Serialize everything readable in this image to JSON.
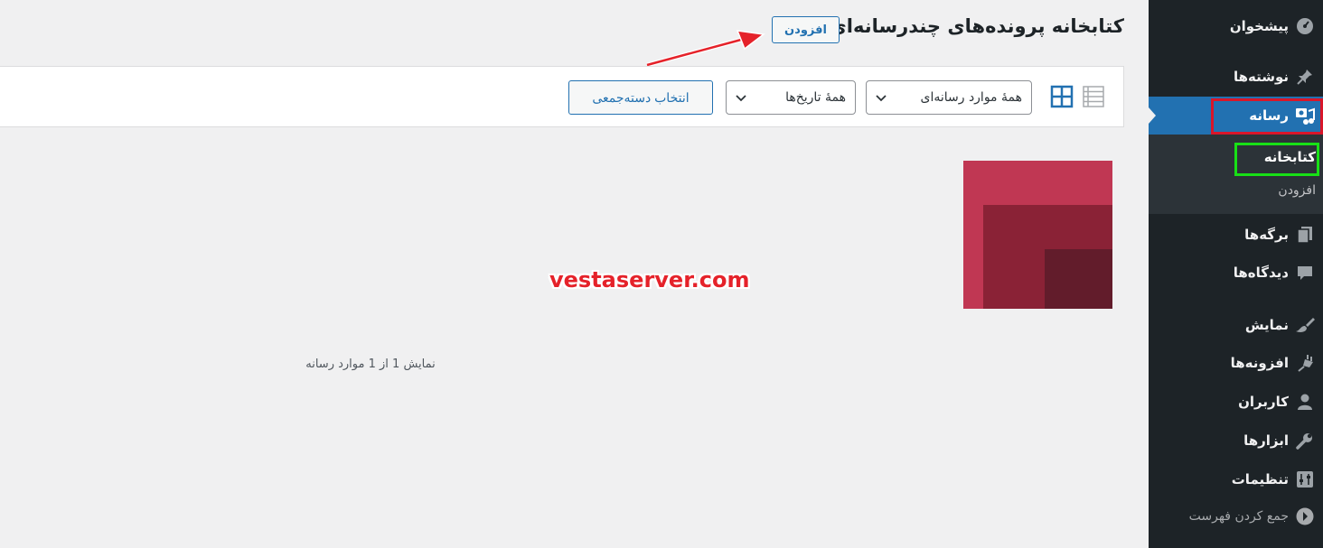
{
  "sidebar": {
    "items": [
      {
        "label": "پیشخوان",
        "icon": "dashboard-icon"
      },
      {
        "label": "نوشته‌ها",
        "icon": "pin-icon"
      },
      {
        "label": "رسانه",
        "icon": "media-icon"
      },
      {
        "label": "برگه‌ها",
        "icon": "pages-icon"
      },
      {
        "label": "دیدگاه‌ها",
        "icon": "comments-icon"
      },
      {
        "label": "نمایش",
        "icon": "appearance-icon"
      },
      {
        "label": "افزونه‌ها",
        "icon": "plugins-icon"
      },
      {
        "label": "کاربران",
        "icon": "users-icon"
      },
      {
        "label": "ابزارها",
        "icon": "tools-icon"
      },
      {
        "label": "تنظیمات",
        "icon": "settings-icon"
      }
    ],
    "submenu": [
      {
        "label": "کتابخانه"
      },
      {
        "label": "افزودن"
      }
    ],
    "collapse_label": "جمع کردن فهرست"
  },
  "header": {
    "title": "کتابخانه پرونده‌های چندرسانه‌ای",
    "add_new_label": "افزودن"
  },
  "toolbar": {
    "media_type_filter": "همهٔ موارد رسانه‌ای",
    "date_filter": "همهٔ تاریخ‌ها",
    "bulk_select_label": "انتخاب دسته‌جمعی"
  },
  "watermark": "vestaserver.com",
  "count_text": "نمایش 1 از 1 موارد رسانه",
  "colors": {
    "sidebar_bg": "#1d2327",
    "accent": "#2271b1",
    "highlight_red": "#d9162a",
    "highlight_green": "#18e016",
    "attachment": "#c03753"
  }
}
